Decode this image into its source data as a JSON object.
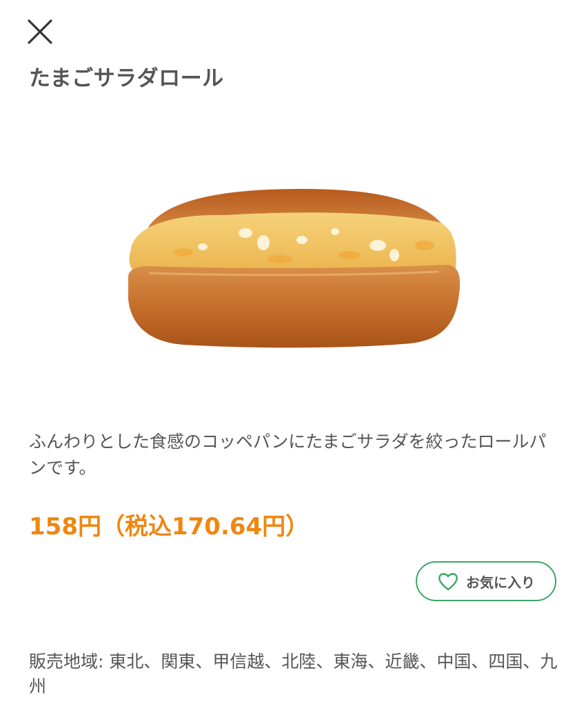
{
  "header": {
    "close_icon": "close-icon"
  },
  "product": {
    "name": "たまごサラダロール",
    "image_alt": "たまごサラダロール",
    "description": "ふんわりとした食感のコッペパンにたまごサラダを絞ったロールパンです。",
    "price": "158円（税込170.64円）"
  },
  "favorite": {
    "label": "お気に入り",
    "icon": "heart-outline-icon"
  },
  "region": {
    "text": "販売地域: 東北、関東、甲信越、北陸、東海、近畿、中国、四国、九州"
  },
  "colors": {
    "accent_price": "#EE8711",
    "favorite_border": "#3CA565",
    "text": "#555555"
  }
}
